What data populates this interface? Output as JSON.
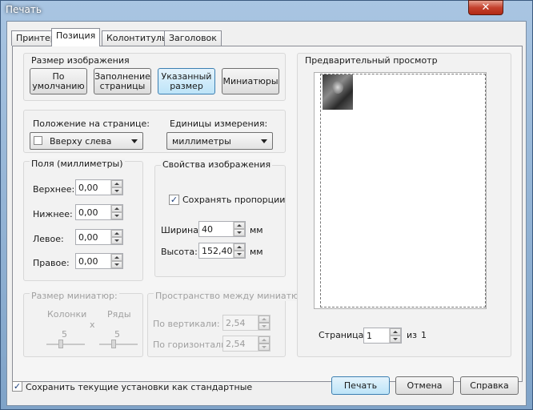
{
  "window": {
    "title": "Печать",
    "close": "✕"
  },
  "tabs": [
    "Принтер",
    "Позиция",
    "Колонтитулы",
    "Заголовок"
  ],
  "image_size": {
    "label": "Размер изображения",
    "buttons": [
      "По умолчанию",
      "Заполнение страницы",
      "Указанный размер",
      "Миниатюры"
    ],
    "selected": "Указанный размер"
  },
  "position": {
    "label": "Положение на странице:",
    "value": "Вверху слева"
  },
  "units": {
    "label": "Единицы измерения:",
    "value": "миллиметры"
  },
  "margins": {
    "label": "Поля (миллиметры)",
    "top_label": "Верхнее:",
    "top": "0,00",
    "bottom_label": "Нижнее:",
    "bottom": "0,00",
    "left_label": "Левое:",
    "left": "0,00",
    "right_label": "Правое:",
    "right": "0,00"
  },
  "image_props": {
    "label": "Свойства изображения",
    "keep_ratio": "Сохранять пропорции",
    "width_label": "Ширина:",
    "width": "40",
    "width_unit": "мм",
    "height_label": "Высота:",
    "height": "152,40",
    "height_unit": "мм"
  },
  "thumbs": {
    "label": "Размер миниатюр:",
    "cols_label": "Колонки",
    "rows_label": "Ряды",
    "cols": "5",
    "rows": "5",
    "times": "x"
  },
  "spacing": {
    "label": "Пространство между миниатюрами:",
    "vert_label": "По вертикали:",
    "vert": "2,54",
    "horiz_label": "По горизонтали:",
    "horiz": "2,54"
  },
  "preview": {
    "label": "Предварительный просмотр"
  },
  "page_nav": {
    "label": "Страница",
    "value": "1",
    "of": "из",
    "total": "1"
  },
  "save_default": "Сохранить текущие установки как стандартные",
  "actions": {
    "print": "Печать",
    "cancel": "Отмена",
    "help": "Справка"
  }
}
